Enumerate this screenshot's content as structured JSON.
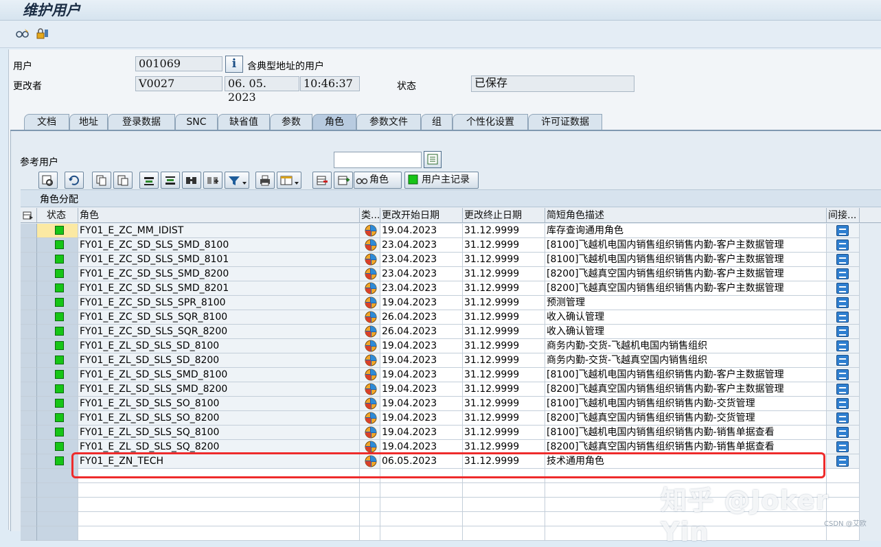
{
  "window": {
    "title": "维护用户"
  },
  "header": {
    "user_label": "用户",
    "user_value": "001069",
    "user_type_text": "含典型地址的用户",
    "changed_by_label": "更改者",
    "changed_by_value": "V0027",
    "date_value": "06. 05. 2023",
    "time_value": "10:46:37",
    "status_label": "状态",
    "status_value": "已保存"
  },
  "tabs": [
    {
      "label": "文档"
    },
    {
      "label": "地址"
    },
    {
      "label": "登录数据"
    },
    {
      "label": "SNC"
    },
    {
      "label": "缺省值"
    },
    {
      "label": "参数"
    },
    {
      "label": "角色"
    },
    {
      "label": "参数文件"
    },
    {
      "label": "组"
    },
    {
      "label": "个性化设置"
    },
    {
      "label": "许可证数据"
    }
  ],
  "active_tab": "角色",
  "ref_user": {
    "label": "参考用户",
    "value": ""
  },
  "toolbar": {
    "role_button_label": "角色",
    "user_master_button_label": "用户主记录"
  },
  "grid": {
    "section_title": "角色分配",
    "columns": [
      "状态",
      "角色",
      "类...",
      "更改开始日期",
      "更改终止日期",
      "简短角色描述",
      "间接..."
    ],
    "rows": [
      {
        "role": "FY01_E_ZC_MM_IDIST",
        "from": "19.04.2023",
        "to": "31.12.9999",
        "desc": "库存查询通用角色"
      },
      {
        "role": "FY01_E_ZC_SD_SLS_SMD_8100",
        "from": "23.04.2023",
        "to": "31.12.9999",
        "desc": "[8100]飞越机电国内销售组织销售内勤-客户主数据管理"
      },
      {
        "role": "FY01_E_ZC_SD_SLS_SMD_8101",
        "from": "23.04.2023",
        "to": "31.12.9999",
        "desc": "[8100]飞越机电国内销售组织销售内勤-客户主数据管理"
      },
      {
        "role": "FY01_E_ZC_SD_SLS_SMD_8200",
        "from": "23.04.2023",
        "to": "31.12.9999",
        "desc": "[8200]飞越真空国内销售组织销售内勤-客户主数据管理"
      },
      {
        "role": "FY01_E_ZC_SD_SLS_SMD_8201",
        "from": "23.04.2023",
        "to": "31.12.9999",
        "desc": "[8200]飞越真空国内销售组织销售内勤-客户主数据管理"
      },
      {
        "role": "FY01_E_ZC_SD_SLS_SPR_8100",
        "from": "19.04.2023",
        "to": "31.12.9999",
        "desc": "预测管理"
      },
      {
        "role": "FY01_E_ZC_SD_SLS_SQR_8100",
        "from": "26.04.2023",
        "to": "31.12.9999",
        "desc": "收入确认管理"
      },
      {
        "role": "FY01_E_ZC_SD_SLS_SQR_8200",
        "from": "26.04.2023",
        "to": "31.12.9999",
        "desc": "收入确认管理"
      },
      {
        "role": "FY01_E_ZL_SD_SLS_SD_8100",
        "from": "19.04.2023",
        "to": "31.12.9999",
        "desc": "商务内勤-交货-飞越机电国内销售组织"
      },
      {
        "role": "FY01_E_ZL_SD_SLS_SD_8200",
        "from": "19.04.2023",
        "to": "31.12.9999",
        "desc": "商务内勤-交货-飞越真空国内销售组织"
      },
      {
        "role": "FY01_E_ZL_SD_SLS_SMD_8100",
        "from": "19.04.2023",
        "to": "31.12.9999",
        "desc": "[8100]飞越机电国内销售组织销售内勤-客户主数据管理"
      },
      {
        "role": "FY01_E_ZL_SD_SLS_SMD_8200",
        "from": "19.04.2023",
        "to": "31.12.9999",
        "desc": "[8200]飞越真空国内销售组织销售内勤-客户主数据管理"
      },
      {
        "role": "FY01_E_ZL_SD_SLS_SO_8100",
        "from": "19.04.2023",
        "to": "31.12.9999",
        "desc": "[8100]飞越机电国内销售组织销售内勤-交货管理"
      },
      {
        "role": "FY01_E_ZL_SD_SLS_SO_8200",
        "from": "19.04.2023",
        "to": "31.12.9999",
        "desc": "[8200]飞越真空国内销售组织销售内勤-交货管理"
      },
      {
        "role": "FY01_E_ZL_SD_SLS_SQ_8100",
        "from": "19.04.2023",
        "to": "31.12.9999",
        "desc": "[8100]飞越机电国内销售组织销售内勤-销售单据查看"
      },
      {
        "role": "FY01_E_ZL_SD_SLS_SQ_8200",
        "from": "19.04.2023",
        "to": "31.12.9999",
        "desc": "[8200]飞越真空国内销售组织销售内勤-销售单据查看"
      },
      {
        "role": "FY01_E_ZN_TECH",
        "from": "06.05.2023",
        "to": "31.12.9999",
        "desc": "技术通用角色"
      }
    ]
  },
  "watermark": {
    "text": "知乎 @Joker Yin",
    "csdn": "CSDN @艾欧"
  },
  "colors": {
    "status_green": "#16c516",
    "highlight_red": "#ee2b2b",
    "indirect_button": "#2f7fd0"
  },
  "icons": [
    "glasses-icon",
    "lock-edit-icon",
    "info-icon",
    "details-icon",
    "refresh-icon",
    "copy-icon",
    "paste-icon",
    "sort-asc-icon",
    "filter-icon",
    "find-icon",
    "find-next-icon",
    "funnel-icon",
    "print-icon",
    "layout-icon",
    "delete-row-icon",
    "insert-row-icon",
    "role-glasses-icon",
    "green-status-icon",
    "role-type-ball-icon",
    "indirect-assign-icon"
  ]
}
